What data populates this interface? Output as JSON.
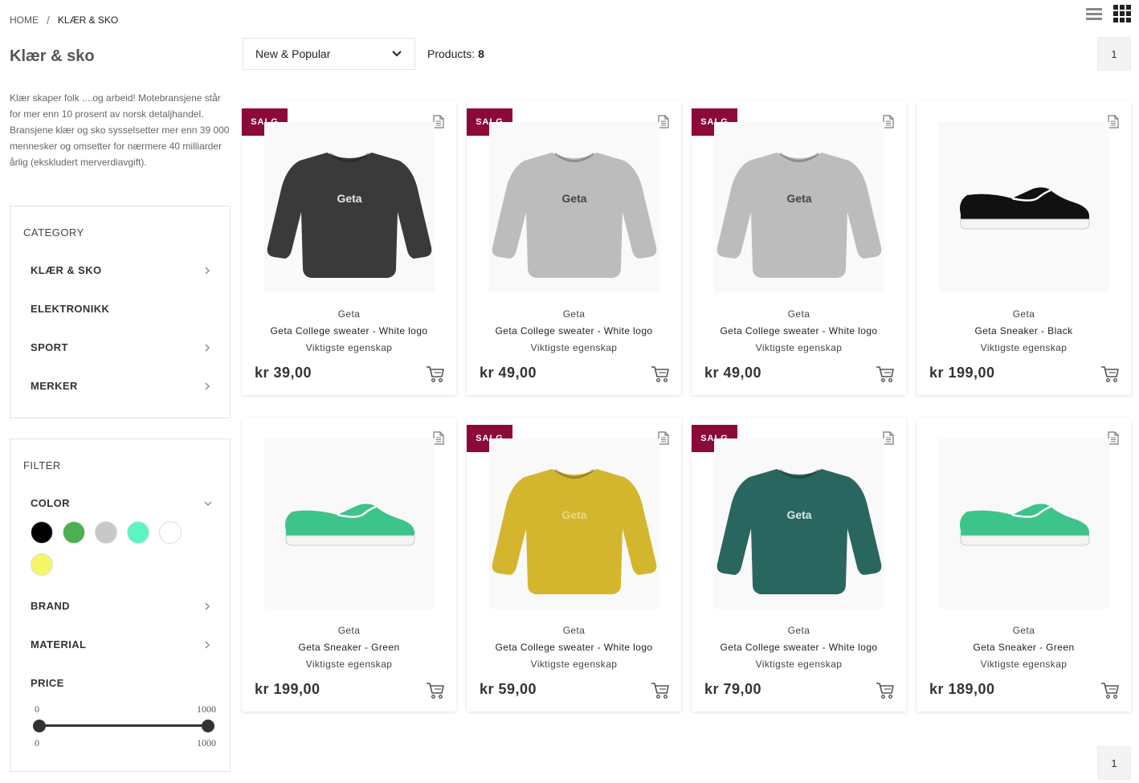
{
  "breadcrumb": {
    "home": "HOME",
    "separator": "/",
    "current": "KLÆR & SKO"
  },
  "view": {
    "list_icon": "list-view-icon",
    "grid_icon": "grid-view-icon",
    "active": "grid"
  },
  "page": {
    "title": "Klær & sko",
    "description": "Klær skaper folk ....og arbeid! Motebransjene står for mer enn 10 prosent av norsk detaljhandel. Bransjene klær og sko sysselsetter mer enn 39 000 mennesker og omsetter for nærmere 40 milliarder årlig (ekskludert merverdiavgift)."
  },
  "category": {
    "title": "CATEGORY",
    "items": [
      {
        "label": "KLÆR & SKO",
        "has_children": true
      },
      {
        "label": "ELEKTRONIKK",
        "has_children": false
      },
      {
        "label": "SPORT",
        "has_children": true
      },
      {
        "label": "MERKER",
        "has_children": true
      }
    ]
  },
  "filter": {
    "title": "FILTER",
    "color": {
      "label": "COLOR",
      "swatches": [
        "#000000",
        "#4caf50",
        "#c8c8c8",
        "#5cf5c0",
        "#ffffff",
        "#f5f56a"
      ]
    },
    "brand": {
      "label": "BRAND"
    },
    "material": {
      "label": "MATERIAL"
    },
    "price": {
      "label": "PRICE",
      "min": "0",
      "max": "1000",
      "selected_min": "0",
      "selected_max": "1000"
    }
  },
  "toolbar": {
    "sort_label": "New & Popular",
    "count_label": "Products:",
    "count_value": "8"
  },
  "pagination": {
    "current": "1"
  },
  "colors": {
    "sale_badge": "#8c0a3a"
  },
  "products": [
    {
      "badge": "SALG",
      "brand": "Geta",
      "name": "Geta College sweater - White logo",
      "feature": "Viktigste egenskap",
      "price": "kr 39,00",
      "kind": "sweater",
      "color": "#3a3a3a",
      "logo_color": "#e8e8e8",
      "logo": "Geta"
    },
    {
      "badge": "SALG",
      "brand": "Geta",
      "name": "Geta College sweater - White logo",
      "feature": "Viktigste egenskap",
      "price": "kr 49,00",
      "kind": "sweater",
      "color": "#bcbcbc",
      "logo_color": "#444444",
      "logo": "Geta"
    },
    {
      "badge": "SALG",
      "brand": "Geta",
      "name": "Geta College sweater - White logo",
      "feature": "Viktigste egenskap",
      "price": "kr 49,00",
      "kind": "sweater",
      "color": "#bcbcbc",
      "logo_color": "#444444",
      "logo": "Geta"
    },
    {
      "badge": "",
      "brand": "Geta",
      "name": "Geta Sneaker - Black",
      "feature": "Viktigste egenskap",
      "price": "kr 199,00",
      "kind": "sneaker",
      "color": "#111111"
    },
    {
      "badge": "",
      "brand": "Geta",
      "name": "Geta Sneaker - Green",
      "feature": "Viktigste egenskap",
      "price": "kr 199,00",
      "kind": "sneaker",
      "color": "#3cc48a"
    },
    {
      "badge": "SALG",
      "brand": "Geta",
      "name": "Geta College sweater - White logo",
      "feature": "Viktigste egenskap",
      "price": "kr 59,00",
      "kind": "sweater",
      "color": "#d4b62e",
      "logo_color": "#e8d88a",
      "logo": "Geta"
    },
    {
      "badge": "SALG",
      "brand": "Geta",
      "name": "Geta College sweater - White logo",
      "feature": "Viktigste egenskap",
      "price": "kr 79,00",
      "kind": "sweater",
      "color": "#2a6660",
      "logo_color": "#d8e8e4",
      "logo": "Geta"
    },
    {
      "badge": "",
      "brand": "Geta",
      "name": "Geta Sneaker - Green",
      "feature": "Viktigste egenskap",
      "price": "kr 189,00",
      "kind": "sneaker",
      "color": "#3cc48a"
    }
  ]
}
